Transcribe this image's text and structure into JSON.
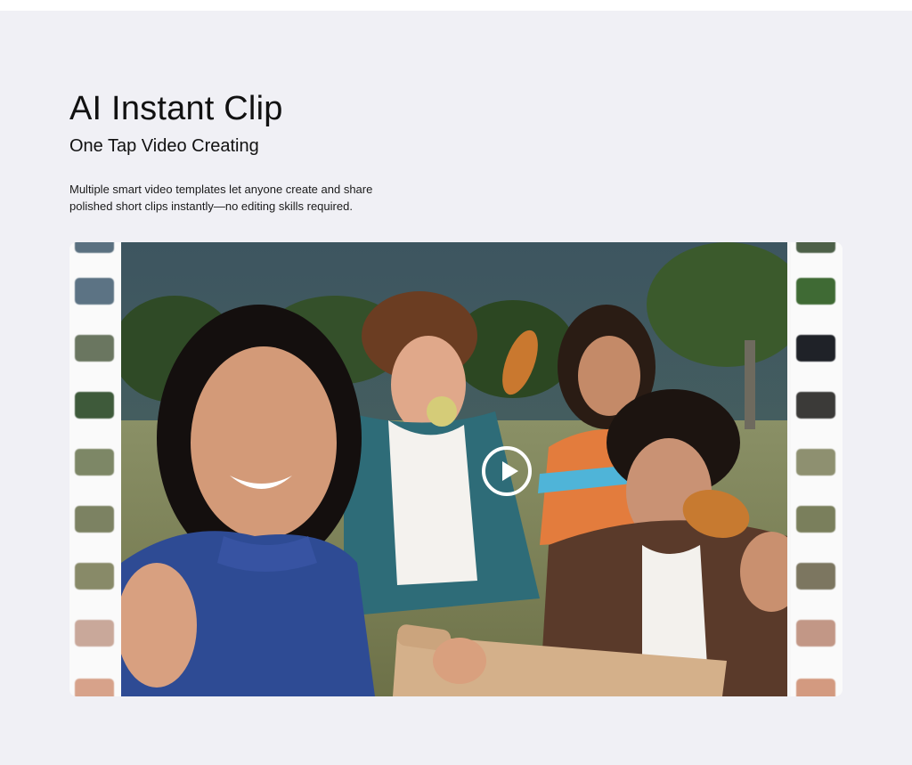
{
  "hero": {
    "title": "AI Instant Clip",
    "subtitle": "One Tap Video Creating",
    "description": "Multiple smart video templates let anyone create and share polished short clips instantly—no editing skills required."
  },
  "video": {
    "scene": "four friends taking a selfie outdoors, eating croissants and apples",
    "play_icon": "play-circle-icon"
  },
  "colors": {
    "background": "#f0f0f5",
    "play_button": "#ffffff"
  }
}
